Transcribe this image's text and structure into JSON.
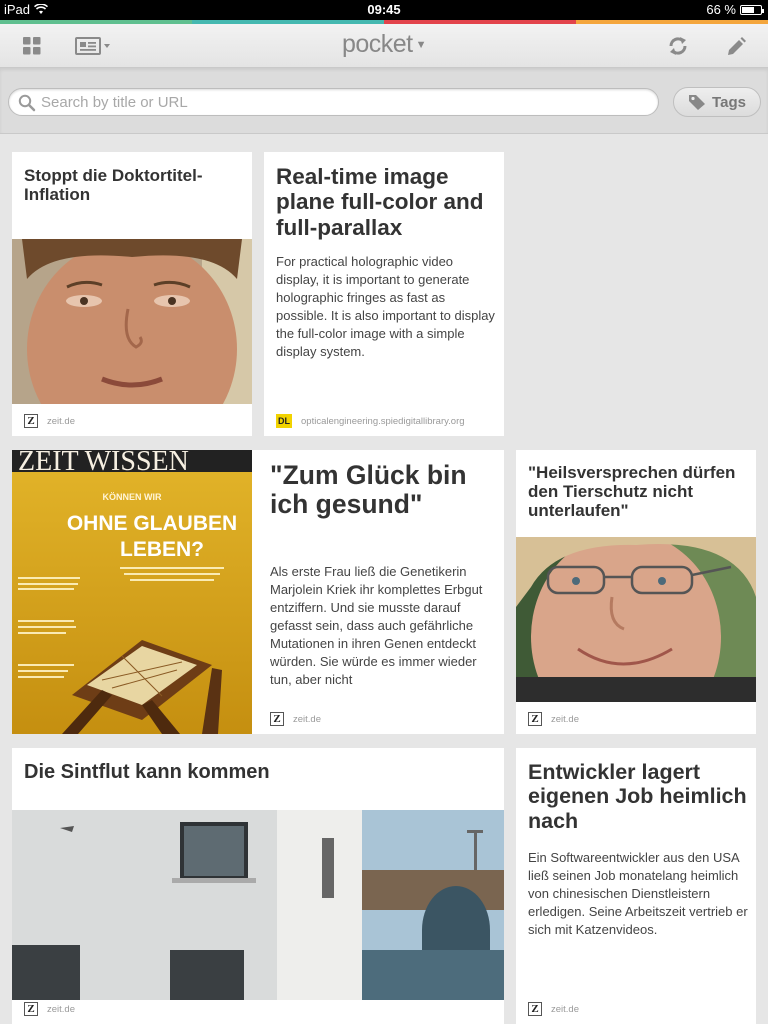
{
  "status_bar": {
    "device": "iPad",
    "time": "09:45",
    "battery": "66 %",
    "battery_level": 0.66
  },
  "color_strip": [
    "#5fbf8f",
    "#45b8b0",
    "#e2434b",
    "#f4a63d"
  ],
  "toolbar": {
    "logo": "pocket",
    "icons": [
      "grid-view-icon",
      "list-view-icon",
      "sync-icon",
      "edit-icon"
    ]
  },
  "search": {
    "placeholder": "Search by title or URL",
    "value": ""
  },
  "tags_button": {
    "label": "Tags"
  },
  "cards": [
    {
      "title": "Stoppt die Doktortitel-Inflation",
      "excerpt": "",
      "source": "zeit.de",
      "image": "portrait-man"
    },
    {
      "title": "Real-time image plane full-color and full-parallax",
      "excerpt": "For practical holographic video display, it is important to generate holographic fringes as fast as possible. It is also important to display the full-color image with a simple display system.",
      "source": "opticalengineering.spiedigitallibrary.org",
      "image": ""
    },
    {
      "title": "\"Zum Glück bin ich gesund\"",
      "excerpt": "Als erste Frau ließ die Genetikerin Marjolein Kriek ihr komplettes Erbgut entziffern. Und sie musste darauf gefasst sein, dass auch gefährliche Mutationen in ihren Genen entdeckt würden. Sie würde es immer wieder tun, aber nicht",
      "source": "zeit.de",
      "image": "magazine-cover"
    },
    {
      "title": "\"Heilsversprechen dürfen den Tierschutz nicht unterlaufen\"",
      "excerpt": "",
      "source": "zeit.de",
      "image": "portrait-woman"
    },
    {
      "title": "Die Sintflut kann kommen",
      "excerpt": "",
      "source": "zeit.de",
      "image": "riverside-houses"
    },
    {
      "title": "Entwickler lagert eigenen Job heimlich nach",
      "excerpt": "Ein Softwareentwickler aus den USA ließ seinen Job monatelang heimlich von chinesischen Dienstleistern erledigen. Seine Arbeitszeit vertrieb er sich mit Katzenvideos.",
      "source": "zeit.de",
      "image": ""
    }
  ],
  "magazine_cover": {
    "masthead": "ZEIT WISSEN",
    "headline_1": "KÖNNEN WIR",
    "headline_2": "OHNE GLAUBEN",
    "headline_3": "LEBEN?"
  }
}
